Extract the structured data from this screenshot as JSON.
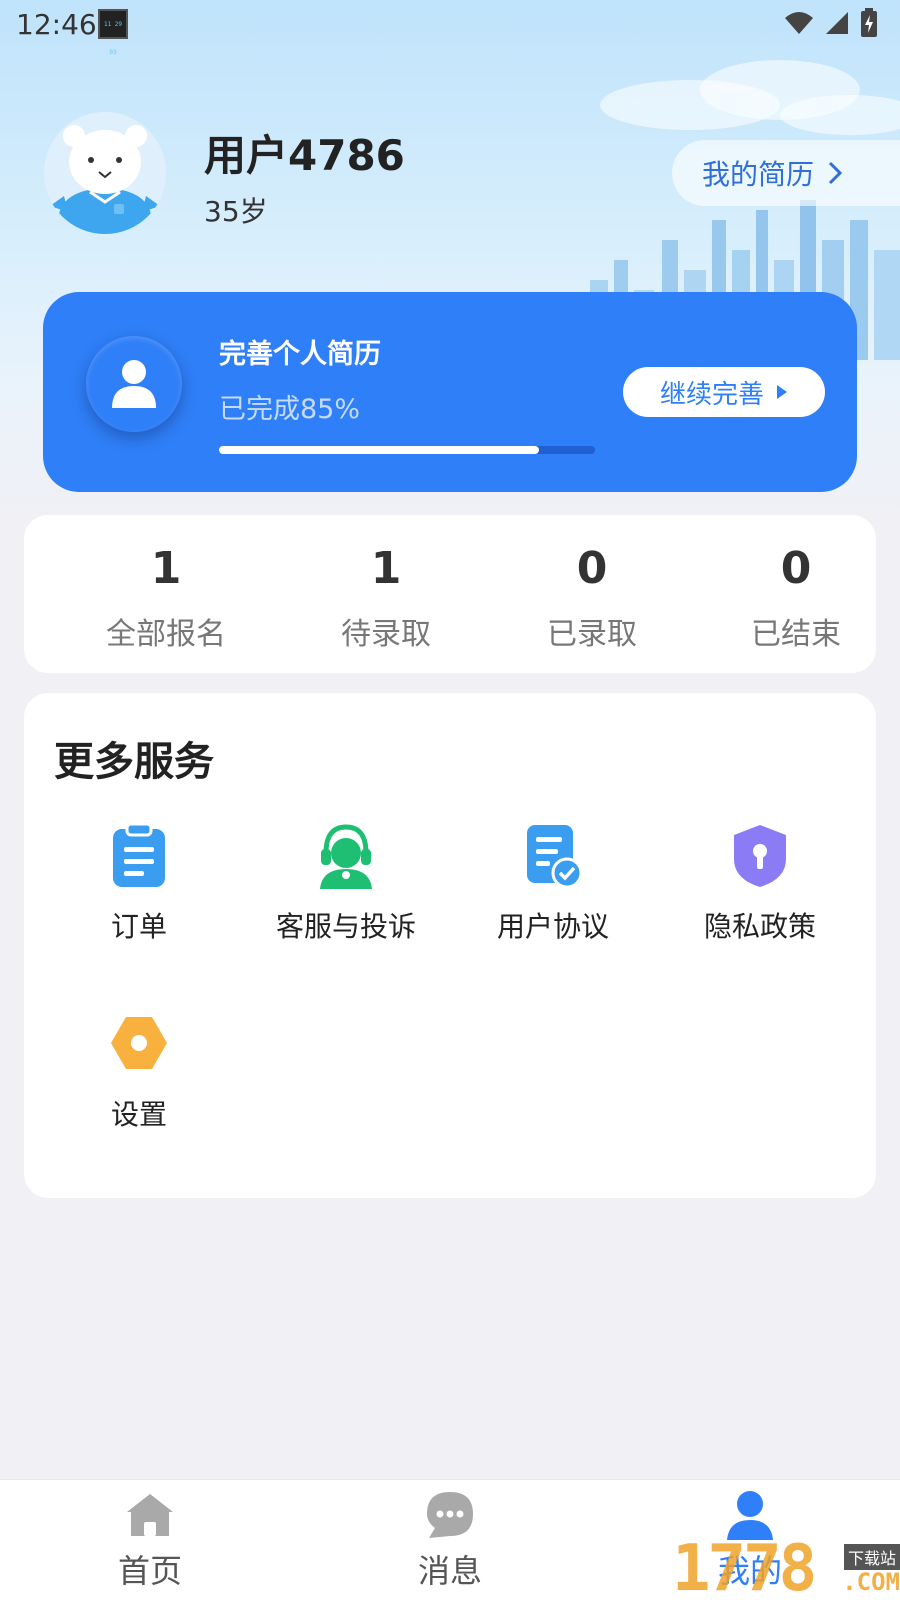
{
  "status_bar": {
    "time": "12:46",
    "thumb_text": "11 29 03"
  },
  "profile": {
    "name": "用户4786",
    "age": "35岁",
    "resume_link_label": "我的简历"
  },
  "complete_card": {
    "title": "完善个人简历",
    "subtitle": "已完成85%",
    "progress_fraction": 0.85,
    "button_label": "继续完善"
  },
  "stats": [
    {
      "value": "1",
      "label": "全部报名"
    },
    {
      "value": "1",
      "label": "待录取"
    },
    {
      "value": "0",
      "label": "已录取"
    },
    {
      "value": "0",
      "label": "已结束"
    }
  ],
  "services": {
    "title": "更多服务",
    "items": [
      {
        "label": "订单",
        "icon": "clipboard-icon"
      },
      {
        "label": "客服与投诉",
        "icon": "headset-agent-icon"
      },
      {
        "label": "用户协议",
        "icon": "document-check-icon"
      },
      {
        "label": "隐私政策",
        "icon": "shield-lock-icon"
      },
      {
        "label": "设置",
        "icon": "hexagon-gear-icon"
      }
    ]
  },
  "bottom_nav": [
    {
      "label": "首页",
      "icon": "home-icon"
    },
    {
      "label": "消息",
      "icon": "message-icon"
    },
    {
      "label": "我的",
      "icon": "person-icon",
      "active": true
    }
  ],
  "watermark": {
    "text": "1778",
    "badge": "下载站",
    "suffix": ".COM"
  },
  "colors": {
    "primary": "#2f7ff8",
    "link": "#2f6fd6",
    "service_blue": "#3a9df0",
    "service_green": "#1fbf73",
    "service_purple": "#8b7cf6",
    "service_orange": "#f8b13f"
  }
}
